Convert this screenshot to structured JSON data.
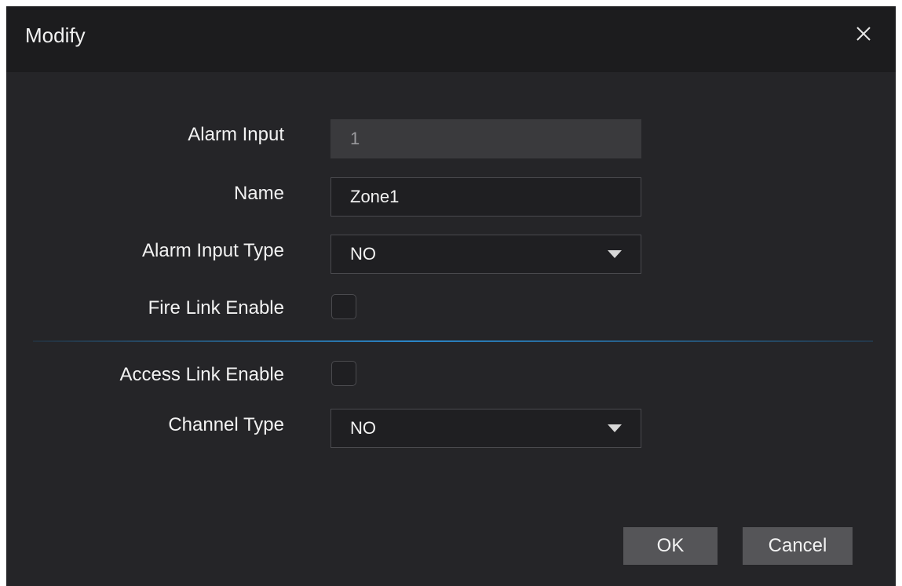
{
  "dialog": {
    "title": "Modify"
  },
  "form": {
    "alarm_input": {
      "label": "Alarm Input",
      "value": "1"
    },
    "name": {
      "label": "Name",
      "value": "Zone1"
    },
    "alarm_input_type": {
      "label": "Alarm Input Type",
      "selected": "NO"
    },
    "fire_link_enable": {
      "label": "Fire Link Enable",
      "checked": false
    },
    "access_link_enable": {
      "label": "Access Link Enable",
      "checked": false
    },
    "channel_type": {
      "label": "Channel Type",
      "selected": "NO"
    }
  },
  "buttons": {
    "ok_label": "OK",
    "cancel_label": "Cancel"
  },
  "icons": {
    "close": "close-icon",
    "dropdown": "chevron-down-icon"
  },
  "colors": {
    "dialog_background": "#252528",
    "titlebar_background": "#1c1c1e",
    "divider_accent": "#2a86c8",
    "button_background": "#555558"
  }
}
